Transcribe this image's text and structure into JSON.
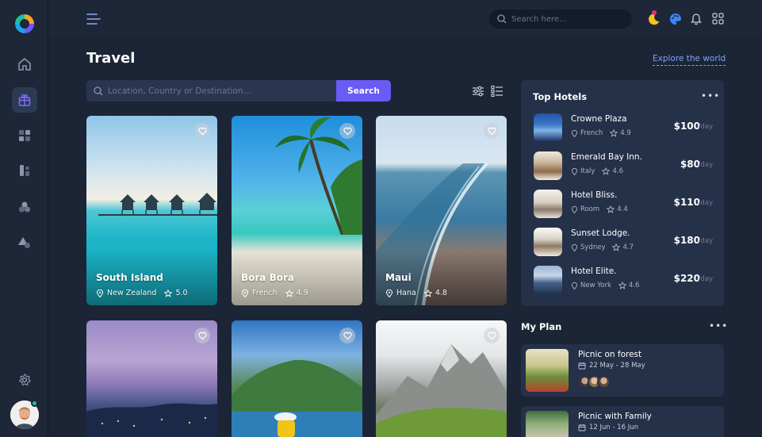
{
  "topbar": {
    "search_placeholder": "Search here..."
  },
  "page": {
    "title": "Travel",
    "explore_link": "Explore the world"
  },
  "search": {
    "placeholder": "Location, Country or Destination...",
    "button": "Search"
  },
  "destinations": [
    {
      "name": "South Island",
      "location": "New Zealand",
      "rating": "5.0"
    },
    {
      "name": "Bora Bora",
      "location": "French",
      "rating": "4.9"
    },
    {
      "name": "Maui",
      "location": "Hana",
      "rating": "4.8"
    }
  ],
  "top_hotels": {
    "title": "Top Hotels",
    "more": "•••",
    "items": [
      {
        "name": "Crowne Plaza",
        "location": "French",
        "rating": "4.9",
        "price": "$100",
        "unit": "/day"
      },
      {
        "name": "Emerald Bay Inn.",
        "location": "Italy",
        "rating": "4.6",
        "price": "$80",
        "unit": "/day"
      },
      {
        "name": "Hotel Bliss.",
        "location": "Room",
        "rating": "4.4",
        "price": "$110",
        "unit": "/day"
      },
      {
        "name": "Sunset Lodge.",
        "location": "Sydney",
        "rating": "4.7",
        "price": "$180",
        "unit": "/day"
      },
      {
        "name": "Hotel Elite.",
        "location": "New York",
        "rating": "4.6",
        "price": "$220",
        "unit": "/day"
      }
    ]
  },
  "my_plan": {
    "title": "My Plan",
    "more": "•••",
    "items": [
      {
        "title": "Picnic on forest",
        "dates": "22 May - 28 May"
      },
      {
        "title": "Picnic with Family",
        "dates": "12 Jun - 16 Jun"
      }
    ]
  },
  "colors": {
    "accent": "#6a5af6",
    "background": "#1c2536",
    "panel": "#253149",
    "link": "#7ba4f0",
    "notification": "#e0307a",
    "online": "#19c4a0"
  }
}
